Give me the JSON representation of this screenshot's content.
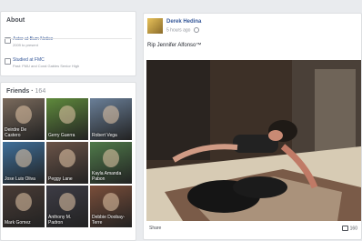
{
  "about": {
    "title": "About",
    "items": [
      {
        "line1": "Actor at Bum Notice",
        "line2": "2009 to present"
      },
      {
        "line1": "Studied at FMC",
        "line2": "Past: FMU and Coral Gables Senior High"
      }
    ]
  },
  "friends": {
    "title": "Friends",
    "count": "164",
    "tiles": [
      {
        "name": "Deirdre De Castro",
        "label": "Deirdre De\nCastero",
        "color": "#7a6a5c"
      },
      {
        "name": "Gerry Guerra",
        "label": "Gerry Guerra",
        "color": "#5f8a3c"
      },
      {
        "name": "Robert Vega",
        "label": "Robert Vega",
        "color": "#6a7f98"
      },
      {
        "name": "Jose Luis Oliva",
        "label": "Jose Luis Oliva",
        "color": "#3f6f9a"
      },
      {
        "name": "Peggy Lane",
        "label": "Peggy Lane",
        "color": "#6b5448"
      },
      {
        "name": "Kayla Amanda Pabon",
        "label": "Kayla Amanda\nPabon",
        "color": "#4f7a4a"
      },
      {
        "name": "Mark Gomez",
        "label": "Mark Gomez",
        "color": "#4a3c36"
      },
      {
        "name": "Anthony M. Padron",
        "label": "Anthony M.\nPadron",
        "color": "#3d3c45"
      },
      {
        "name": "Debbie Doobay-Terre",
        "label": "Debbie Doobay-\nTerre",
        "color": "#7a4e3a"
      }
    ]
  },
  "post": {
    "author": "Derek Hedina",
    "time": "5 hours ago",
    "text": "Rip Jennifer Alfonso™",
    "share_label": "Share",
    "comment_count": "160"
  },
  "colors": {
    "link": "#365899",
    "background": "#e9ebee"
  },
  "icons": {
    "privacy": "globe-icon",
    "comment": "comment-icon",
    "work": "briefcase-icon",
    "education": "graduation-cap-icon"
  }
}
